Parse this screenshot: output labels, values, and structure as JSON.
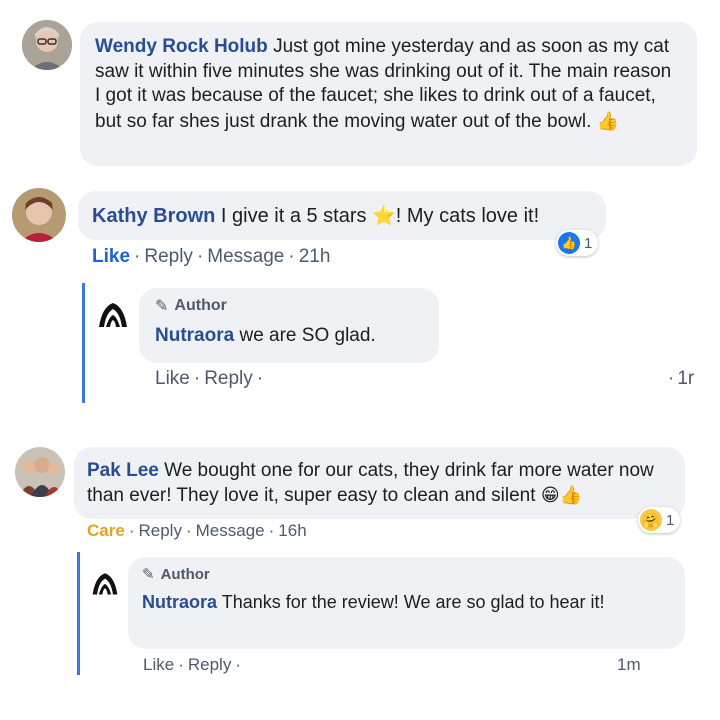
{
  "comments": [
    {
      "author": "Wendy Rock Holub",
      "text": "Just got mine yesterday and as soon as my cat saw it within five minutes she was drinking out of it. The main reason I got it was because of the faucet; she likes to drink out of a faucet, but so far shes just drank the moving water out of the bowl."
    },
    {
      "author": "Kathy Brown",
      "text_before": "I give it a 5 stars",
      "text_after": "! My cats love it!",
      "actions": {
        "like": "Like",
        "reply": "Reply",
        "message": "Message",
        "time": "21h"
      },
      "reaction_count": "1",
      "reply": {
        "badge": "Author",
        "author": "Nutraora",
        "text": "we are SO glad.",
        "actions": {
          "like": "Like",
          "reply": "Reply",
          "time": "1r"
        }
      }
    },
    {
      "author": "Pak Lee",
      "text": "We bought one for our cats, they drink far more water now than ever! They love it, super easy to clean and silent",
      "actions": {
        "care": "Care",
        "reply": "Reply",
        "message": "Message",
        "time": "16h"
      },
      "reaction_count": "1",
      "reply": {
        "badge": "Author",
        "author": "Nutraora",
        "text": "Thanks for the review! We are so glad to hear it!",
        "actions": {
          "like": "Like",
          "reply": "Reply",
          "time": "1m"
        }
      }
    }
  ],
  "icons": {
    "thumbs_up": "thumbs-up-emoji",
    "star": "star-emoji",
    "grin": "grinning-emoji",
    "hug": "care-reaction-icon",
    "like": "like-reaction-icon",
    "pencil": "pencil-icon",
    "brand_logo": "nutraora-logo"
  },
  "colors": {
    "name_blue": "#2a4c93",
    "link_blue": "#1c62d8",
    "bubble_bg": "#eff1f4",
    "thread_line": "#3b77e0",
    "care_gold": "#e0a323"
  }
}
